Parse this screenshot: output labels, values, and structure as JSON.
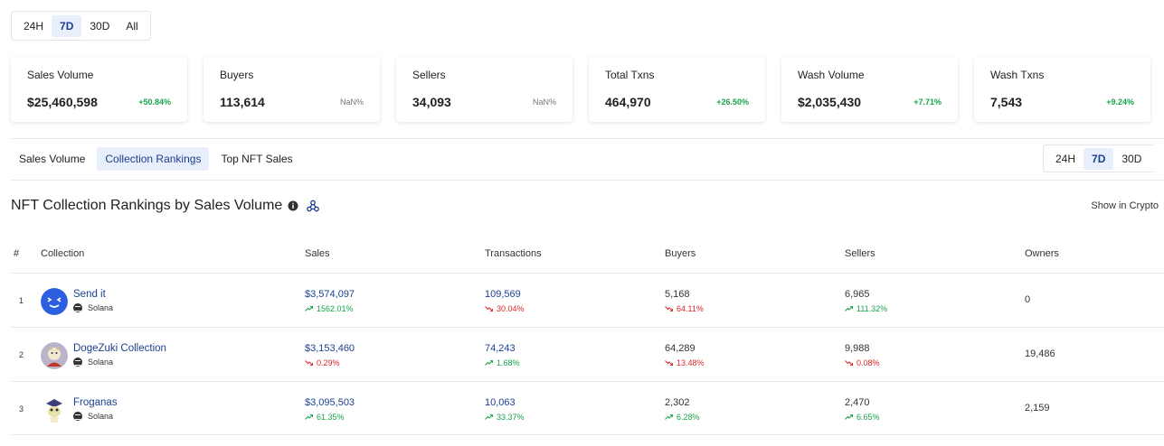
{
  "time_filters": {
    "options": [
      "24H",
      "7D",
      "30D",
      "All"
    ],
    "active": "7D"
  },
  "stat_cards": [
    {
      "label": "Sales Volume",
      "value": "$25,460,598",
      "change": "+50.84%",
      "trend": "up"
    },
    {
      "label": "Buyers",
      "value": "113,614",
      "change": "NaN%",
      "trend": "neutral"
    },
    {
      "label": "Sellers",
      "value": "34,093",
      "change": "NaN%",
      "trend": "neutral"
    },
    {
      "label": "Total Txns",
      "value": "464,970",
      "change": "+26.50%",
      "trend": "up"
    },
    {
      "label": "Wash Volume",
      "value": "$2,035,430",
      "change": "+7.71%",
      "trend": "up"
    },
    {
      "label": "Wash Txns",
      "value": "7,543",
      "change": "+9.24%",
      "trend": "up"
    }
  ],
  "tabs": [
    "Sales Volume",
    "Collection Rankings",
    "Top NFT Sales"
  ],
  "active_tab": "Collection Rankings",
  "table_filters": {
    "options": [
      "24H",
      "7D",
      "30D"
    ],
    "active": "7D"
  },
  "section_title": "NFT Collection Rankings by Sales Volume",
  "crypto_toggle_label": "Show in Crypto",
  "table": {
    "headers": [
      "#",
      "Collection",
      "Sales",
      "Transactions",
      "Buyers",
      "Sellers",
      "Owners"
    ],
    "rows": [
      {
        "rank": "1",
        "name": "Send it",
        "chain": "Solana",
        "avatar": "send-it-avatar",
        "sales": "$3,574,097",
        "sales_change": "1562.01%",
        "sales_trend": "up",
        "transactions": "109,569",
        "transactions_change": "30.04%",
        "transactions_trend": "down",
        "buyers": "5,168",
        "buyers_change": "64.11%",
        "buyers_trend": "down",
        "sellers": "6,965",
        "sellers_change": "111.32%",
        "sellers_trend": "up",
        "owners": "0"
      },
      {
        "rank": "2",
        "name": "DogeZuki Collection",
        "chain": "Solana",
        "avatar": "dogezuki-avatar",
        "sales": "$3,153,460",
        "sales_change": "0.29%",
        "sales_trend": "down",
        "transactions": "74,243",
        "transactions_change": "1.68%",
        "transactions_trend": "up",
        "buyers": "64,289",
        "buyers_change": "13.48%",
        "buyers_trend": "down",
        "sellers": "9,988",
        "sellers_change": "0.08%",
        "sellers_trend": "down",
        "owners": "19,486"
      },
      {
        "rank": "3",
        "name": "Froganas",
        "chain": "Solana",
        "avatar": "froganas-avatar",
        "sales": "$3,095,503",
        "sales_change": "61.35%",
        "sales_trend": "up",
        "transactions": "10,063",
        "transactions_change": "33.37%",
        "transactions_trend": "up",
        "buyers": "2,302",
        "buyers_change": "6.28%",
        "buyers_trend": "up",
        "sellers": "2,470",
        "sellers_change": "6.65%",
        "sellers_trend": "up",
        "owners": "2,159"
      }
    ]
  },
  "colors": {
    "accent": "#1a3f8f",
    "active_bg": "#e8eefb",
    "up": "#16a34a",
    "down": "#dc2626"
  }
}
